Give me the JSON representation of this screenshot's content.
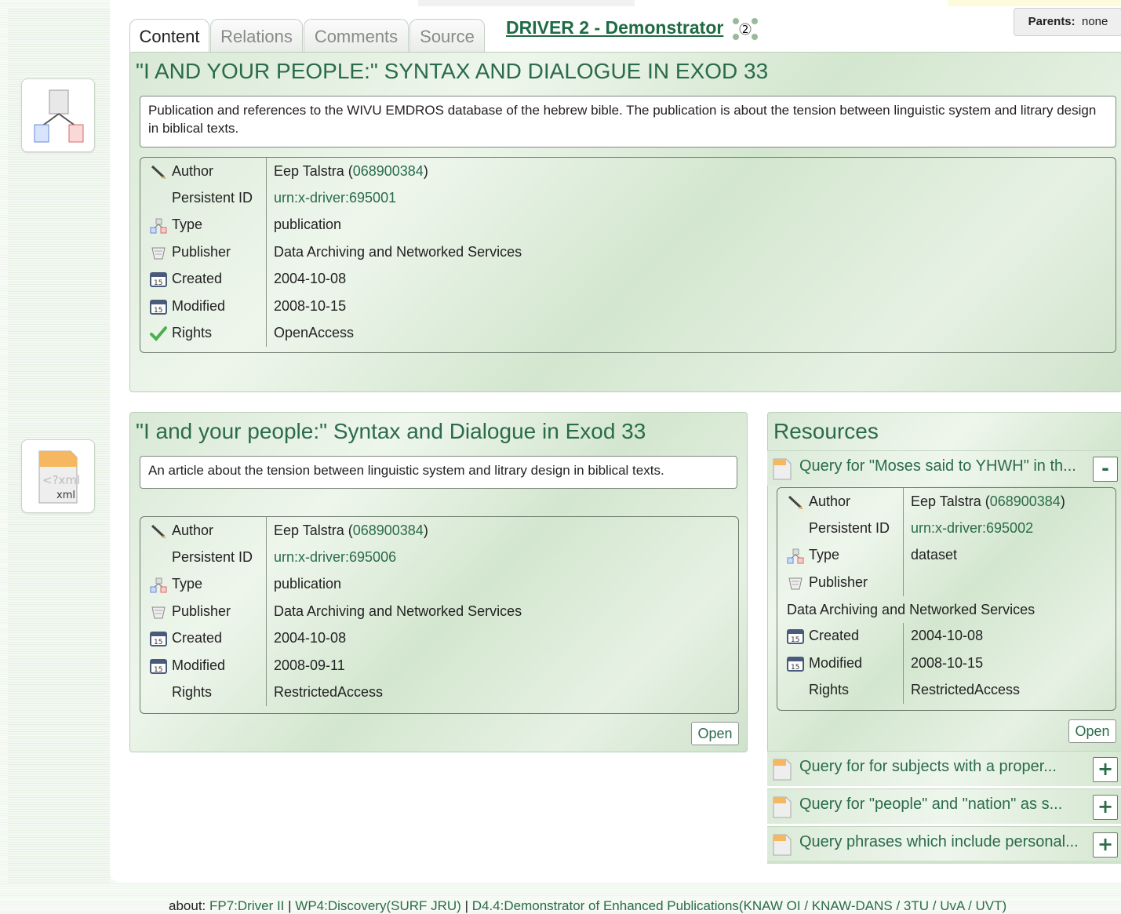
{
  "tabs": [
    "Content",
    "Relations",
    "Comments",
    "Source"
  ],
  "header": {
    "demo_title": "DRIVER 2 - Demonstrator",
    "demo_badge": "2",
    "parents_label": "Parents:",
    "parents_value": "none"
  },
  "sidebar": {
    "items": [
      {
        "icon": "hierarchy-icon"
      },
      {
        "icon": "xml-file-icon",
        "xml_text": "<?xml",
        "xml_label": "xml"
      }
    ]
  },
  "main_record": {
    "title": "\"I AND YOUR PEOPLE:\" SYNTAX AND DIALOGUE IN EXOD 33",
    "description": "Publication and references to the WIVU EMDROS database of the hebrew bible. The publication is about the tension between linguistic system and litrary design in biblical texts.",
    "fields": [
      {
        "icon": "pencil-icon",
        "label": "Author",
        "value": "Eep Talstra (",
        "link": "068900384",
        "suffix": ")"
      },
      {
        "icon": "",
        "label": "Persistent ID",
        "value": "",
        "link": "urn:x-driver:695001",
        "suffix": ""
      },
      {
        "icon": "type-icon",
        "label": "Type",
        "value": "publication",
        "link": "",
        "suffix": ""
      },
      {
        "icon": "publisher-icon",
        "label": "Publisher",
        "value": "Data Archiving and Networked Services",
        "link": "",
        "suffix": ""
      },
      {
        "icon": "calendar-icon",
        "label": "Created",
        "value": "2004-10-08",
        "link": "",
        "suffix": ""
      },
      {
        "icon": "calendar-icon",
        "label": "Modified",
        "value": "2008-10-15",
        "link": "",
        "suffix": ""
      },
      {
        "icon": "check-icon",
        "label": "Rights",
        "value": "OpenAccess",
        "link": "",
        "suffix": ""
      }
    ]
  },
  "article": {
    "title": "\"I and your people:\" Syntax and Dialogue in Exod 33",
    "description": "An article about the tension between linguistic system and litrary design in biblical texts.",
    "fields": [
      {
        "icon": "pencil-icon",
        "label": "Author",
        "value": "Eep Talstra (",
        "link": "068900384",
        "suffix": ")"
      },
      {
        "icon": "",
        "label": "Persistent ID",
        "value": "",
        "link": "urn:x-driver:695006",
        "suffix": ""
      },
      {
        "icon": "type-icon",
        "label": "Type",
        "value": "publication",
        "link": "",
        "suffix": ""
      },
      {
        "icon": "publisher-icon",
        "label": "Publisher",
        "value": "Data Archiving and Networked Services",
        "link": "",
        "suffix": ""
      },
      {
        "icon": "calendar-icon",
        "label": "Created",
        "value": "2004-10-08",
        "link": "",
        "suffix": ""
      },
      {
        "icon": "calendar-icon",
        "label": "Modified",
        "value": "2008-09-11",
        "link": "",
        "suffix": ""
      },
      {
        "icon": "",
        "label": "Rights",
        "value": "RestrictedAccess",
        "link": "",
        "suffix": ""
      }
    ],
    "open_label": "Open"
  },
  "resources": {
    "title": "Resources",
    "expanded": {
      "label": "Query for \"Moses said to YHWH\" in th...",
      "toggle": "-",
      "fields_top": [
        {
          "icon": "pencil-icon",
          "label": "Author",
          "value": "Eep Talstra (",
          "link": "068900384",
          "suffix": ")"
        },
        {
          "icon": "",
          "label": "Persistent ID",
          "value": "",
          "link": "urn:x-driver:695002",
          "suffix": ""
        },
        {
          "icon": "type-icon",
          "label": "Type",
          "value": "dataset",
          "link": "",
          "suffix": ""
        },
        {
          "icon": "publisher-icon",
          "label": "Publisher",
          "value": "",
          "link": "",
          "suffix": ""
        }
      ],
      "publisher_overflow": "Data Archiving and Networked Services",
      "fields_bottom": [
        {
          "icon": "calendar-icon",
          "label": "Created",
          "value": "2004-10-08",
          "link": "",
          "suffix": ""
        },
        {
          "icon": "calendar-icon",
          "label": "Modified",
          "value": "2008-10-15",
          "link": "",
          "suffix": ""
        },
        {
          "icon": "",
          "label": "Rights",
          "value": "RestrictedAccess",
          "link": "",
          "suffix": ""
        }
      ],
      "open_label": "Open"
    },
    "collapsed": [
      {
        "label": "Query for for subjects with a proper...",
        "toggle": "+"
      },
      {
        "label": "Query for \"people\" and \"nation\" as s...",
        "toggle": "+"
      },
      {
        "label": "Query phrases which include personal...",
        "toggle": "+"
      }
    ]
  },
  "footer": {
    "about": "about:",
    "links": [
      "FP7:Driver II",
      "WP4:Discovery(SURF JRU)",
      "D4.4:Demonstrator of Enhanced Publications(KNAW OI / KNAW-DANS / 3TU / UvA / UVT)"
    ],
    "separator": " | "
  },
  "colors": {
    "accent": "#2a6b4a",
    "title": "#1e6b44",
    "panel": "#dcebd9"
  }
}
